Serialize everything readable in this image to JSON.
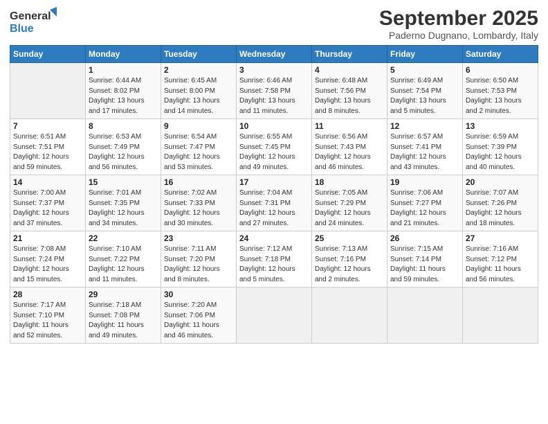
{
  "logo": {
    "line1": "General",
    "line2": "Blue"
  },
  "title": "September 2025",
  "subtitle": "Paderno Dugnano, Lombardy, Italy",
  "days_header": [
    "Sunday",
    "Monday",
    "Tuesday",
    "Wednesday",
    "Thursday",
    "Friday",
    "Saturday"
  ],
  "weeks": [
    [
      {
        "day": "",
        "info": ""
      },
      {
        "day": "1",
        "info": "Sunrise: 6:44 AM\nSunset: 8:02 PM\nDaylight: 13 hours\nand 17 minutes."
      },
      {
        "day": "2",
        "info": "Sunrise: 6:45 AM\nSunset: 8:00 PM\nDaylight: 13 hours\nand 14 minutes."
      },
      {
        "day": "3",
        "info": "Sunrise: 6:46 AM\nSunset: 7:58 PM\nDaylight: 13 hours\nand 11 minutes."
      },
      {
        "day": "4",
        "info": "Sunrise: 6:48 AM\nSunset: 7:56 PM\nDaylight: 13 hours\nand 8 minutes."
      },
      {
        "day": "5",
        "info": "Sunrise: 6:49 AM\nSunset: 7:54 PM\nDaylight: 13 hours\nand 5 minutes."
      },
      {
        "day": "6",
        "info": "Sunrise: 6:50 AM\nSunset: 7:53 PM\nDaylight: 13 hours\nand 2 minutes."
      }
    ],
    [
      {
        "day": "7",
        "info": "Sunrise: 6:51 AM\nSunset: 7:51 PM\nDaylight: 12 hours\nand 59 minutes."
      },
      {
        "day": "8",
        "info": "Sunrise: 6:53 AM\nSunset: 7:49 PM\nDaylight: 12 hours\nand 56 minutes."
      },
      {
        "day": "9",
        "info": "Sunrise: 6:54 AM\nSunset: 7:47 PM\nDaylight: 12 hours\nand 53 minutes."
      },
      {
        "day": "10",
        "info": "Sunrise: 6:55 AM\nSunset: 7:45 PM\nDaylight: 12 hours\nand 49 minutes."
      },
      {
        "day": "11",
        "info": "Sunrise: 6:56 AM\nSunset: 7:43 PM\nDaylight: 12 hours\nand 46 minutes."
      },
      {
        "day": "12",
        "info": "Sunrise: 6:57 AM\nSunset: 7:41 PM\nDaylight: 12 hours\nand 43 minutes."
      },
      {
        "day": "13",
        "info": "Sunrise: 6:59 AM\nSunset: 7:39 PM\nDaylight: 12 hours\nand 40 minutes."
      }
    ],
    [
      {
        "day": "14",
        "info": "Sunrise: 7:00 AM\nSunset: 7:37 PM\nDaylight: 12 hours\nand 37 minutes."
      },
      {
        "day": "15",
        "info": "Sunrise: 7:01 AM\nSunset: 7:35 PM\nDaylight: 12 hours\nand 34 minutes."
      },
      {
        "day": "16",
        "info": "Sunrise: 7:02 AM\nSunset: 7:33 PM\nDaylight: 12 hours\nand 30 minutes."
      },
      {
        "day": "17",
        "info": "Sunrise: 7:04 AM\nSunset: 7:31 PM\nDaylight: 12 hours\nand 27 minutes."
      },
      {
        "day": "18",
        "info": "Sunrise: 7:05 AM\nSunset: 7:29 PM\nDaylight: 12 hours\nand 24 minutes."
      },
      {
        "day": "19",
        "info": "Sunrise: 7:06 AM\nSunset: 7:27 PM\nDaylight: 12 hours\nand 21 minutes."
      },
      {
        "day": "20",
        "info": "Sunrise: 7:07 AM\nSunset: 7:26 PM\nDaylight: 12 hours\nand 18 minutes."
      }
    ],
    [
      {
        "day": "21",
        "info": "Sunrise: 7:08 AM\nSunset: 7:24 PM\nDaylight: 12 hours\nand 15 minutes."
      },
      {
        "day": "22",
        "info": "Sunrise: 7:10 AM\nSunset: 7:22 PM\nDaylight: 12 hours\nand 11 minutes."
      },
      {
        "day": "23",
        "info": "Sunrise: 7:11 AM\nSunset: 7:20 PM\nDaylight: 12 hours\nand 8 minutes."
      },
      {
        "day": "24",
        "info": "Sunrise: 7:12 AM\nSunset: 7:18 PM\nDaylight: 12 hours\nand 5 minutes."
      },
      {
        "day": "25",
        "info": "Sunrise: 7:13 AM\nSunset: 7:16 PM\nDaylight: 12 hours\nand 2 minutes."
      },
      {
        "day": "26",
        "info": "Sunrise: 7:15 AM\nSunset: 7:14 PM\nDaylight: 11 hours\nand 59 minutes."
      },
      {
        "day": "27",
        "info": "Sunrise: 7:16 AM\nSunset: 7:12 PM\nDaylight: 11 hours\nand 56 minutes."
      }
    ],
    [
      {
        "day": "28",
        "info": "Sunrise: 7:17 AM\nSunset: 7:10 PM\nDaylight: 11 hours\nand 52 minutes."
      },
      {
        "day": "29",
        "info": "Sunrise: 7:18 AM\nSunset: 7:08 PM\nDaylight: 11 hours\nand 49 minutes."
      },
      {
        "day": "30",
        "info": "Sunrise: 7:20 AM\nSunset: 7:06 PM\nDaylight: 11 hours\nand 46 minutes."
      },
      {
        "day": "",
        "info": ""
      },
      {
        "day": "",
        "info": ""
      },
      {
        "day": "",
        "info": ""
      },
      {
        "day": "",
        "info": ""
      }
    ]
  ]
}
